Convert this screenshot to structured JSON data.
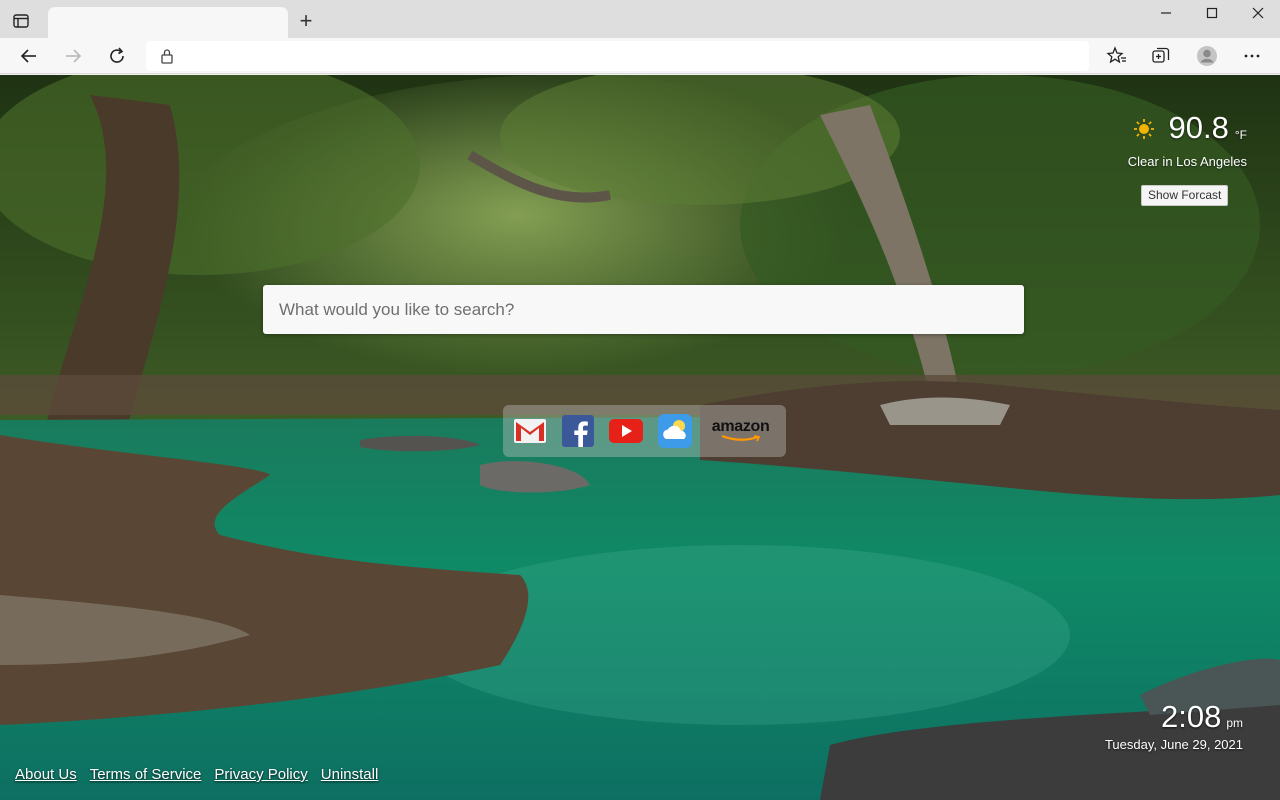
{
  "browser": {
    "address_value": "",
    "icons": {
      "tab_actions": "tab-actions-icon",
      "new_tab": "+",
      "minimize": "minimize-icon",
      "maximize": "maximize-icon",
      "close": "close-icon",
      "back": "back-arrow-icon",
      "forward": "forward-arrow-icon",
      "refresh": "refresh-icon",
      "lock": "lock-icon",
      "favorites": "favorites-star-icon",
      "collections": "collections-icon",
      "profile": "profile-avatar-icon",
      "menu": "more-menu-icon"
    }
  },
  "weather": {
    "temperature": "90.8",
    "unit": "°F",
    "condition": "Clear in Los Angeles",
    "forecast_button": "Show Forcast",
    "icon": "sun-icon",
    "accent": "#f5b301"
  },
  "search": {
    "placeholder": "What would you like to search?"
  },
  "quick_links": [
    {
      "name": "Gmail",
      "icon": "gmail-icon"
    },
    {
      "name": "Facebook",
      "icon": "facebook-icon"
    },
    {
      "name": "YouTube",
      "icon": "youtube-icon"
    },
    {
      "name": "Weather",
      "icon": "weather-cloud-icon"
    },
    {
      "name": "Amazon",
      "label": "amazon",
      "icon": "amazon-logo"
    }
  ],
  "clock": {
    "time": "2:08",
    "ampm": "pm",
    "date": "Tuesday, June 29, 2021"
  },
  "footer": {
    "links": [
      "About Us",
      "Terms of Service",
      "Privacy Policy",
      "Uninstall"
    ]
  }
}
